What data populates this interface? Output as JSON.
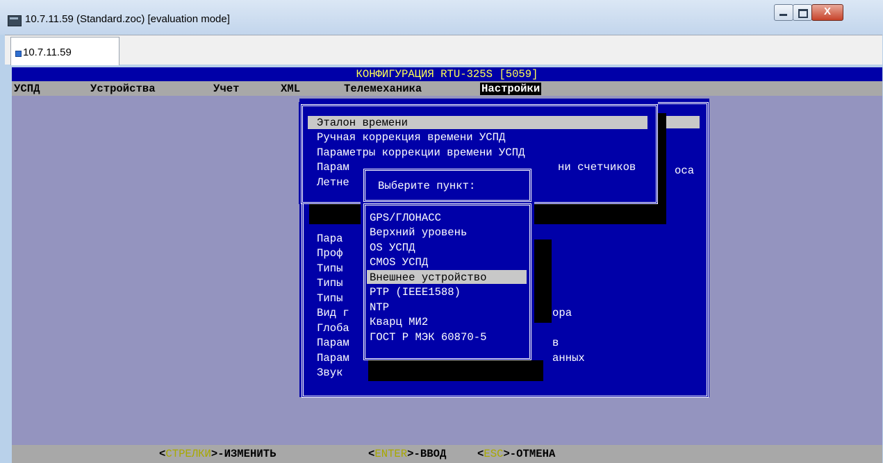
{
  "window": {
    "title": "10.7.11.59 (Standard.zoc) [evaluation mode]",
    "minimize_glyph": "",
    "maximize_glyph": "",
    "close_glyph": "X"
  },
  "tab": {
    "label": "10.7.11.59"
  },
  "terminal": {
    "title": "КОНФИГУРАЦИЯ RTU-325S [5059]",
    "menu": [
      "УСПД",
      "Устройства",
      "Учет",
      "XML",
      "Телемеханика",
      "Настройки"
    ],
    "settings_menu": {
      "highlighted": "Эталон времени",
      "items_top": [
        "Ручная коррекция времени УСПД",
        "Параметры коррекции времени УСПД",
        "Парам",
        "ни счетчиков",
        "оса",
        "Летне"
      ],
      "items_lower": [
        "Пара",
        "Проф",
        "Типы",
        "Типы",
        "Типы",
        "Вид г",
        "Глоба",
        "Парам",
        "Парам",
        "Звук"
      ],
      "lower_tails": [
        "ора",
        "в",
        "анных"
      ]
    },
    "popup": {
      "prompt": "Выберите пункт:",
      "items": [
        "GPS/ГЛОНАСС",
        "Верхний уровень",
        "OS УСПД",
        "CMOS УСПД",
        "Внешнее устройство",
        "PTP (IEEE1588)",
        "NTP",
        "Кварц МИ2",
        "ГОСТ Р МЭК 60870-5"
      ],
      "selected_index": 4
    },
    "hints": [
      {
        "open": "<",
        "key": "СТРЕЛКИ",
        "close": ">-ИЗМЕНИТЬ"
      },
      {
        "open": "<",
        "key": "ENTER",
        "close": ">-ВВОД"
      },
      {
        "open": "<",
        "key": "ESC",
        "close": ">-ОТМЕНА"
      }
    ]
  }
}
